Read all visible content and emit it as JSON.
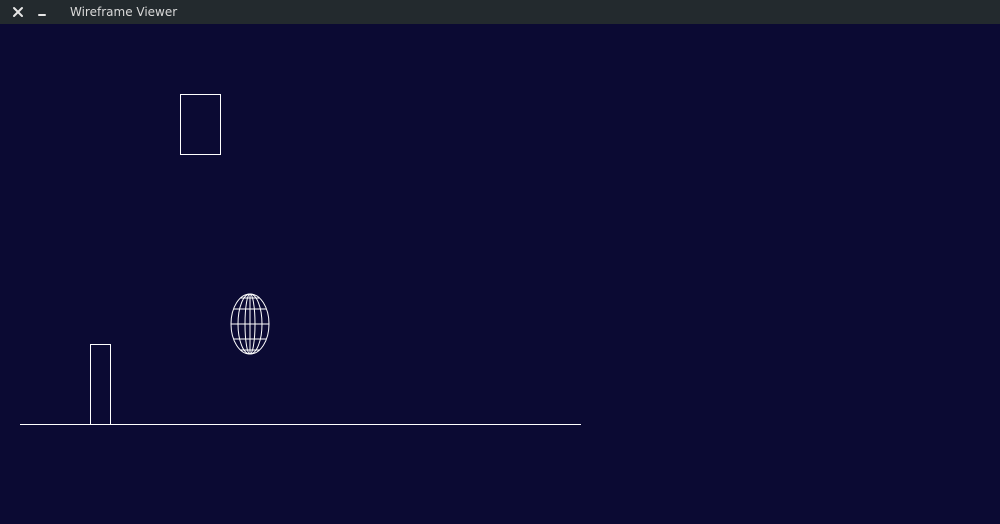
{
  "window": {
    "title": "Wireframe Viewer",
    "close_icon": "close-icon",
    "minimize_icon": "minimize-icon"
  },
  "colors": {
    "titlebar": "#232a2e",
    "background": "#0b0a33",
    "wireframe": "#ffffff"
  }
}
